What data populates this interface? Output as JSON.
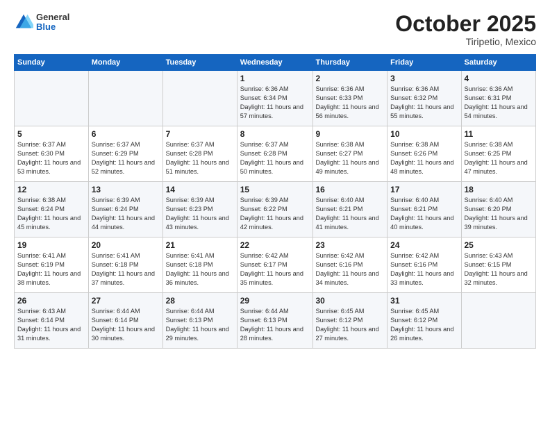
{
  "header": {
    "logo": {
      "general": "General",
      "blue": "Blue"
    },
    "month": "October 2025",
    "location": "Tiripetio, Mexico"
  },
  "weekdays": [
    "Sunday",
    "Monday",
    "Tuesday",
    "Wednesday",
    "Thursday",
    "Friday",
    "Saturday"
  ],
  "weeks": [
    [
      null,
      null,
      null,
      {
        "day": 1,
        "sunrise": "6:36 AM",
        "sunset": "6:34 PM",
        "daylight": "11 hours and 57 minutes."
      },
      {
        "day": 2,
        "sunrise": "6:36 AM",
        "sunset": "6:33 PM",
        "daylight": "11 hours and 56 minutes."
      },
      {
        "day": 3,
        "sunrise": "6:36 AM",
        "sunset": "6:32 PM",
        "daylight": "11 hours and 55 minutes."
      },
      {
        "day": 4,
        "sunrise": "6:36 AM",
        "sunset": "6:31 PM",
        "daylight": "11 hours and 54 minutes."
      }
    ],
    [
      {
        "day": 5,
        "sunrise": "6:37 AM",
        "sunset": "6:30 PM",
        "daylight": "11 hours and 53 minutes."
      },
      {
        "day": 6,
        "sunrise": "6:37 AM",
        "sunset": "6:29 PM",
        "daylight": "11 hours and 52 minutes."
      },
      {
        "day": 7,
        "sunrise": "6:37 AM",
        "sunset": "6:28 PM",
        "daylight": "11 hours and 51 minutes."
      },
      {
        "day": 8,
        "sunrise": "6:37 AM",
        "sunset": "6:28 PM",
        "daylight": "11 hours and 50 minutes."
      },
      {
        "day": 9,
        "sunrise": "6:38 AM",
        "sunset": "6:27 PM",
        "daylight": "11 hours and 49 minutes."
      },
      {
        "day": 10,
        "sunrise": "6:38 AM",
        "sunset": "6:26 PM",
        "daylight": "11 hours and 48 minutes."
      },
      {
        "day": 11,
        "sunrise": "6:38 AM",
        "sunset": "6:25 PM",
        "daylight": "11 hours and 47 minutes."
      }
    ],
    [
      {
        "day": 12,
        "sunrise": "6:38 AM",
        "sunset": "6:24 PM",
        "daylight": "11 hours and 45 minutes."
      },
      {
        "day": 13,
        "sunrise": "6:39 AM",
        "sunset": "6:24 PM",
        "daylight": "11 hours and 44 minutes."
      },
      {
        "day": 14,
        "sunrise": "6:39 AM",
        "sunset": "6:23 PM",
        "daylight": "11 hours and 43 minutes."
      },
      {
        "day": 15,
        "sunrise": "6:39 AM",
        "sunset": "6:22 PM",
        "daylight": "11 hours and 42 minutes."
      },
      {
        "day": 16,
        "sunrise": "6:40 AM",
        "sunset": "6:21 PM",
        "daylight": "11 hours and 41 minutes."
      },
      {
        "day": 17,
        "sunrise": "6:40 AM",
        "sunset": "6:21 PM",
        "daylight": "11 hours and 40 minutes."
      },
      {
        "day": 18,
        "sunrise": "6:40 AM",
        "sunset": "6:20 PM",
        "daylight": "11 hours and 39 minutes."
      }
    ],
    [
      {
        "day": 19,
        "sunrise": "6:41 AM",
        "sunset": "6:19 PM",
        "daylight": "11 hours and 38 minutes."
      },
      {
        "day": 20,
        "sunrise": "6:41 AM",
        "sunset": "6:18 PM",
        "daylight": "11 hours and 37 minutes."
      },
      {
        "day": 21,
        "sunrise": "6:41 AM",
        "sunset": "6:18 PM",
        "daylight": "11 hours and 36 minutes."
      },
      {
        "day": 22,
        "sunrise": "6:42 AM",
        "sunset": "6:17 PM",
        "daylight": "11 hours and 35 minutes."
      },
      {
        "day": 23,
        "sunrise": "6:42 AM",
        "sunset": "6:16 PM",
        "daylight": "11 hours and 34 minutes."
      },
      {
        "day": 24,
        "sunrise": "6:42 AM",
        "sunset": "6:16 PM",
        "daylight": "11 hours and 33 minutes."
      },
      {
        "day": 25,
        "sunrise": "6:43 AM",
        "sunset": "6:15 PM",
        "daylight": "11 hours and 32 minutes."
      }
    ],
    [
      {
        "day": 26,
        "sunrise": "6:43 AM",
        "sunset": "6:14 PM",
        "daylight": "11 hours and 31 minutes."
      },
      {
        "day": 27,
        "sunrise": "6:44 AM",
        "sunset": "6:14 PM",
        "daylight": "11 hours and 30 minutes."
      },
      {
        "day": 28,
        "sunrise": "6:44 AM",
        "sunset": "6:13 PM",
        "daylight": "11 hours and 29 minutes."
      },
      {
        "day": 29,
        "sunrise": "6:44 AM",
        "sunset": "6:13 PM",
        "daylight": "11 hours and 28 minutes."
      },
      {
        "day": 30,
        "sunrise": "6:45 AM",
        "sunset": "6:12 PM",
        "daylight": "11 hours and 27 minutes."
      },
      {
        "day": 31,
        "sunrise": "6:45 AM",
        "sunset": "6:12 PM",
        "daylight": "11 hours and 26 minutes."
      },
      null
    ]
  ]
}
